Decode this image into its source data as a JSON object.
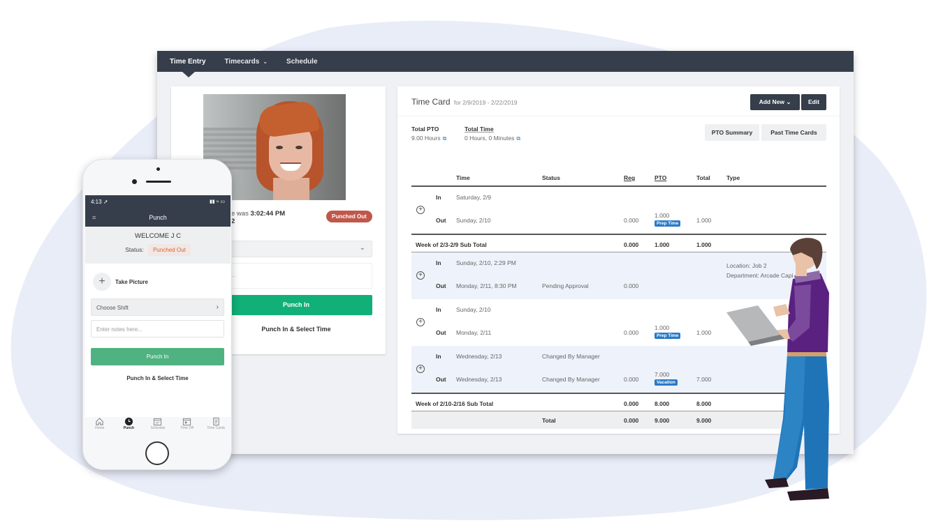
{
  "colors": {
    "nav_bg": "#353e4a",
    "accent_green": "#11b079",
    "mobile_green": "#4fb281",
    "punched_out_red": "#c0574a",
    "tag_blue": "#2a7ac7",
    "blob_bg": "#e9edf8"
  },
  "desktop": {
    "nav": {
      "items": [
        {
          "label": "Time Entry",
          "active": true,
          "dropdown": false
        },
        {
          "label": "Timecards",
          "active": false,
          "dropdown": true
        },
        {
          "label": "Schedule",
          "active": false,
          "dropdown": false
        }
      ]
    },
    "punch_card": {
      "last_punch_prefix": "e was",
      "last_punch_time": "3:02:44 PM",
      "last_punch_line2": "2",
      "status_badge": "Punched Out",
      "notes_placeholder": "re...",
      "punch_in_label": "Punch In",
      "punch_select_time_label": "Punch In & Select Time"
    },
    "timecard": {
      "title": "Time Card",
      "range": "for 2/9/2019 - 2/22/2019",
      "add_new_label": "Add New",
      "edit_label": "Edit",
      "total_pto_label": "Total PTO",
      "total_pto_value": "9.00 Hours",
      "total_time_label": "Total Time",
      "total_time_value": "0 Hours, 0 Minutes",
      "pto_summary_label": "PTO Summary",
      "past_time_cards_label": "Past Time Cards",
      "columns": {
        "time": "Time",
        "status": "Status",
        "reg": "Reg",
        "pto": "PTO",
        "total": "Total",
        "type": "Type"
      },
      "entries": [
        {
          "in_label": "In",
          "in_time": "Saturday, 2/9",
          "in_status": "",
          "out_label": "Out",
          "out_time": "Sunday, 2/10",
          "out_status": "",
          "reg": "0.000",
          "pto": "1.000",
          "pto_tag": "Prep Time",
          "total": "1.000",
          "type_line1": "",
          "type_line2": "",
          "shaded": false
        },
        {
          "subtotal": true,
          "label": "Week of 2/3-2/9 Sub Total",
          "reg": "0.000",
          "pto": "1.000",
          "total": "1.000"
        },
        {
          "in_label": "In",
          "in_time": "Sunday, 2/10, 2:29 PM",
          "in_status": "",
          "out_label": "Out",
          "out_time": "Monday, 2/11, 8:30 PM",
          "out_status": "Pending Approval",
          "reg": "0.000",
          "pto": "",
          "pto_tag": "",
          "total": "",
          "type_line1": "Location: Job 2",
          "type_line2": "Department: Arcade Capi",
          "shaded": true
        },
        {
          "in_label": "In",
          "in_time": "Sunday, 2/10",
          "in_status": "",
          "out_label": "Out",
          "out_time": "Monday, 2/11",
          "out_status": "",
          "reg": "0.000",
          "pto": "1.000",
          "pto_tag": "Prep Time",
          "total": "1.000",
          "type_line1": "",
          "type_line2": "",
          "shaded": false
        },
        {
          "in_label": "In",
          "in_time": "Wednesday, 2/13",
          "in_status": "Changed By Manager",
          "out_label": "Out",
          "out_time": "Wednesday, 2/13",
          "out_status": "Changed By Manager",
          "reg": "0.000",
          "pto": "7.000",
          "pto_tag": "Vacation",
          "total": "7.000",
          "type_line1": "",
          "type_line2": "",
          "shaded": true
        },
        {
          "subtotal": true,
          "label": "Week of 2/10-2/16 Sub Total",
          "reg": "0.000",
          "pto": "8.000",
          "total": "8.000"
        }
      ],
      "grand_total": {
        "label": "Total",
        "reg": "0.000",
        "pto": "9.000",
        "total": "9.000"
      }
    }
  },
  "mobile": {
    "time": "4:13",
    "title": "Punch",
    "welcome": "WELCOME J C",
    "status_label": "Status:",
    "status_value": "Punched Out",
    "take_picture_label": "Take Picture",
    "choose_shift_label": "Choose Shift",
    "notes_placeholder": "Enter notes here...",
    "punch_in_label": "Punch In",
    "punch_select_time_label": "Punch In & Select Time",
    "tabs": [
      {
        "label": "Home",
        "icon": "home-icon",
        "active": false
      },
      {
        "label": "Punch",
        "icon": "clock-icon",
        "active": true
      },
      {
        "label": "Schedule",
        "icon": "calendar-grid-icon",
        "active": false
      },
      {
        "label": "Time Off",
        "icon": "calendar-icon",
        "active": false
      },
      {
        "label": "Time Cards",
        "icon": "document-icon",
        "active": false
      }
    ]
  }
}
